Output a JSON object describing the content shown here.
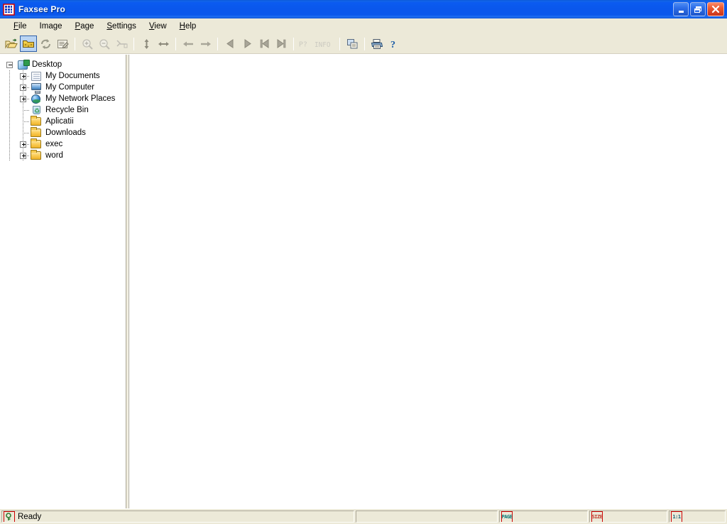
{
  "window": {
    "title": "Faxsee Pro",
    "icon": "faxsee-app-icon",
    "controls": {
      "minimize": "Minimize",
      "maximize": "Maximize",
      "close": "Close"
    },
    "colors": {
      "titlebar_blue": "#0a57ec",
      "chrome_beige": "#ece9d8",
      "client_white": "#ffffff",
      "close_red": "#ec5b32",
      "pressed_highlight": "#bad4f2"
    }
  },
  "menubar": {
    "items": [
      {
        "label": "File",
        "accel": "F"
      },
      {
        "label": "Image",
        "accel": "I"
      },
      {
        "label": "Page",
        "accel": "P"
      },
      {
        "label": "Settings",
        "accel": "S"
      },
      {
        "label": "View",
        "accel": "V"
      },
      {
        "label": "Help",
        "accel": "H"
      }
    ]
  },
  "toolbar": {
    "buttons": [
      {
        "name": "open-file",
        "icon": "open-folder-icon",
        "tooltip": "Open",
        "state": "enabled"
      },
      {
        "name": "browse-folder",
        "icon": "yellow-folder-icon",
        "tooltip": "Browse Folder",
        "state": "pressed"
      },
      {
        "name": "refresh",
        "icon": "refresh-arrows-icon",
        "tooltip": "Refresh",
        "state": "enabled"
      },
      {
        "name": "properties",
        "icon": "properties-page-icon",
        "tooltip": "Properties",
        "state": "enabled"
      },
      {
        "sep": true
      },
      {
        "name": "zoom-in",
        "icon": "magnifier-plus-icon",
        "tooltip": "Zoom In",
        "state": "disabled"
      },
      {
        "name": "zoom-out",
        "icon": "magnifier-minus-icon",
        "tooltip": "Zoom Out",
        "state": "disabled"
      },
      {
        "name": "fit-width",
        "icon": "fit-width-icon",
        "tooltip": "Fit Width",
        "state": "disabled"
      },
      {
        "sep": true
      },
      {
        "name": "stretch-vertical",
        "icon": "arrow-updown-icon",
        "tooltip": "Stretch Vertical",
        "state": "enabled"
      },
      {
        "name": "stretch-horizontal",
        "icon": "arrow-leftright-icon",
        "tooltip": "Stretch Horizontal",
        "state": "enabled"
      },
      {
        "sep": true
      },
      {
        "name": "back",
        "icon": "arrow-left-icon",
        "tooltip": "Back",
        "state": "enabled"
      },
      {
        "name": "forward",
        "icon": "arrow-right-icon",
        "tooltip": "Forward",
        "state": "enabled"
      },
      {
        "sep": true
      },
      {
        "name": "prev-page",
        "icon": "triangle-left-icon",
        "tooltip": "Previous Page",
        "state": "enabled"
      },
      {
        "name": "next-page",
        "icon": "triangle-right-icon",
        "tooltip": "Next Page",
        "state": "enabled"
      },
      {
        "name": "first-page",
        "icon": "skip-first-icon",
        "tooltip": "First Page",
        "state": "enabled"
      },
      {
        "name": "last-page",
        "icon": "skip-last-icon",
        "tooltip": "Last Page",
        "state": "enabled"
      },
      {
        "sep": true
      },
      {
        "name": "page-info",
        "icon": "page-question-icon",
        "label": "P?",
        "tooltip": "Page Info",
        "state": "disabled"
      },
      {
        "name": "info",
        "icon": "info-text-icon",
        "label": "INFO",
        "tooltip": "Info",
        "state": "disabled"
      },
      {
        "sep": true
      },
      {
        "name": "copy-to",
        "icon": "copy-pages-icon",
        "tooltip": "Copy",
        "state": "enabled"
      },
      {
        "sep": true
      },
      {
        "name": "print",
        "icon": "printer-icon",
        "tooltip": "Print",
        "state": "enabled"
      },
      {
        "name": "about",
        "icon": "help-question-icon",
        "tooltip": "About",
        "state": "enabled"
      }
    ]
  },
  "tree": {
    "nodes": [
      {
        "label": "Desktop",
        "icon": "desktop-icon",
        "depth": 0,
        "expander": "minus"
      },
      {
        "label": "My Documents",
        "icon": "documents-icon",
        "depth": 1,
        "expander": "plus"
      },
      {
        "label": "My Computer",
        "icon": "computer-icon",
        "depth": 1,
        "expander": "plus"
      },
      {
        "label": "My Network Places",
        "icon": "network-globe-icon",
        "depth": 1,
        "expander": "plus"
      },
      {
        "label": "Recycle Bin",
        "icon": "recycle-bin-icon",
        "depth": 1,
        "expander": "none"
      },
      {
        "label": "Aplicatii",
        "icon": "folder-icon",
        "depth": 1,
        "expander": "none"
      },
      {
        "label": "Downloads",
        "icon": "folder-icon",
        "depth": 1,
        "expander": "none"
      },
      {
        "label": "exec",
        "icon": "folder-icon",
        "depth": 1,
        "expander": "plus"
      },
      {
        "label": "word",
        "icon": "folder-icon",
        "depth": 1,
        "expander": "plus"
      }
    ]
  },
  "document": {
    "content": "",
    "state": "empty"
  },
  "statusbar": {
    "message": "Ready",
    "message_icon": "key-help-icon",
    "pane2": "",
    "page_indicator": "PAGE",
    "size_indicator": "SIZE",
    "zoom_indicator": "1:1"
  }
}
